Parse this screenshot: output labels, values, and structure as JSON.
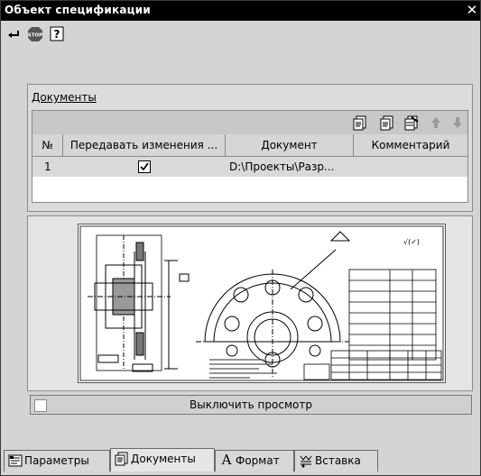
{
  "window": {
    "title": "Объект спецификации",
    "close_glyph": "✕"
  },
  "toolbar": {
    "buttons": [
      {
        "icon": "enter-arrow-icon"
      },
      {
        "icon": "stop-icon",
        "text": "STOP"
      },
      {
        "icon": "help-icon",
        "text": "?"
      }
    ]
  },
  "documents": {
    "label": "Документы",
    "toolbar_icons": [
      "add-document-icon",
      "remove-document-icon",
      "edit-document-icon",
      "move-up-icon",
      "move-down-icon"
    ],
    "columns": [
      "№",
      "Передавать изменения ...",
      "Документ",
      "Комментарий"
    ],
    "rows": [
      {
        "num": "1",
        "transfer_changes": true,
        "document": "D:\\Проекты\\Разр...",
        "comment": ""
      }
    ]
  },
  "preview": {
    "toggle_label": "Выключить просмотр"
  },
  "tabs": [
    {
      "label": "Параметры",
      "icon": "parameters-icon"
    },
    {
      "label": "Документы",
      "icon": "documents-icon",
      "active": true
    },
    {
      "label": "Формат",
      "icon": "format-icon",
      "glyph": "A"
    },
    {
      "label": "Вставка",
      "icon": "insert-icon"
    }
  ],
  "colors": {
    "titlebar": "#000000",
    "panel": "#d4d4d4",
    "selected_row": "#d9d9d9"
  }
}
